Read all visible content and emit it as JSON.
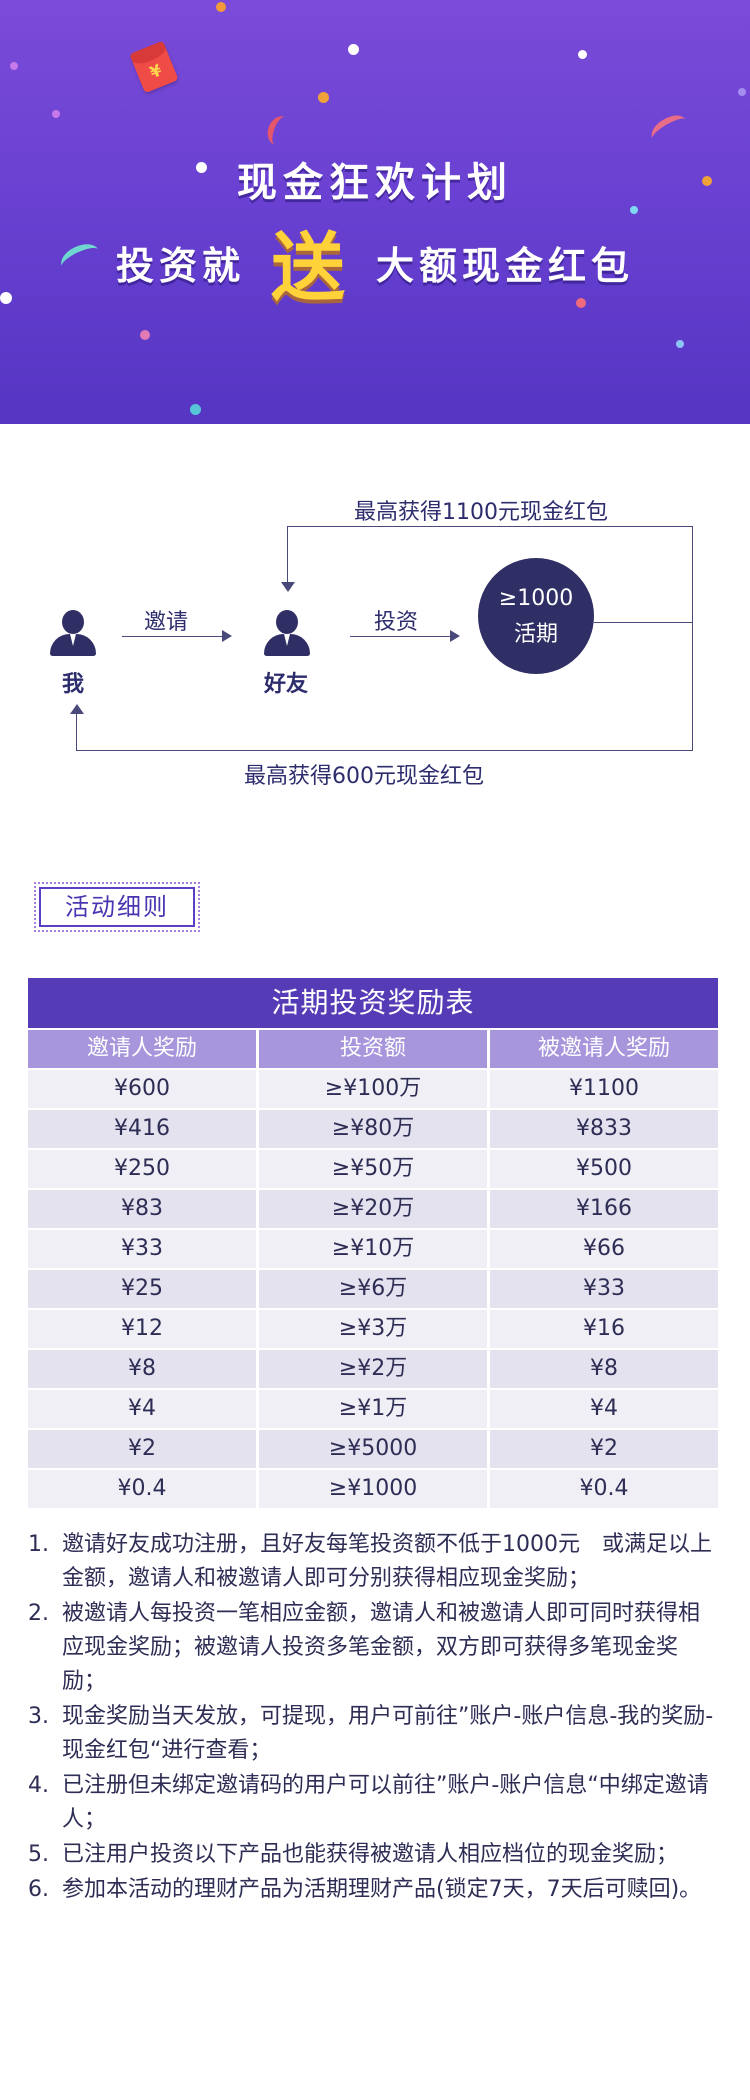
{
  "banner": {
    "title": "现金狂欢计划",
    "sub_before": "投资就",
    "sub_highlight": "送",
    "sub_after": "大额现金红包",
    "envelope_symbol": "¥",
    "colors": {
      "bg_top": "#7b4bd8",
      "bg_bottom": "#5635c3",
      "highlight": "#ffd23a"
    }
  },
  "flow": {
    "me_label": "我",
    "friend_label": "好友",
    "invite_label": "邀请",
    "invest_label": "投资",
    "circle_line1": "≥1000",
    "circle_line2": "活期",
    "top_reward": "最高获得1100元现金红包",
    "bottom_reward": "最高获得600元现金红包"
  },
  "details_tag": "活动细则",
  "table": {
    "title": "活期投资奖励表",
    "headers": [
      "邀请人奖励",
      "投资额",
      "被邀请人奖励"
    ],
    "rows": [
      [
        "¥600",
        "≥¥100万",
        "¥1100"
      ],
      [
        "¥416",
        "≥¥80万",
        "¥833"
      ],
      [
        "¥250",
        "≥¥50万",
        "¥500"
      ],
      [
        "¥83",
        "≥¥20万",
        "¥166"
      ],
      [
        "¥33",
        "≥¥10万",
        "¥66"
      ],
      [
        "¥25",
        "≥¥6万",
        "¥33"
      ],
      [
        "¥12",
        "≥¥3万",
        "¥16"
      ],
      [
        "¥8",
        "≥¥2万",
        "¥8"
      ],
      [
        "¥4",
        "≥¥1万",
        "¥4"
      ],
      [
        "¥2",
        "≥¥5000",
        "¥2"
      ],
      [
        "¥0.4",
        "≥¥1000",
        "¥0.4"
      ]
    ]
  },
  "rules": [
    {
      "num": "1.",
      "text": "邀请好友成功注册，且好友每笔投资额不低于1000元　或满足以上金额，邀请人和被邀请人即可分别获得相应现金奖励；"
    },
    {
      "num": "2.",
      "text": "被邀请人每投资一笔相应金额，邀请人和被邀请人即可同时获得相应现金奖励；被邀请人投资多笔金额，双方即可获得多笔现金奖励；"
    },
    {
      "num": "3.",
      "text": "现金奖励当天发放，可提现，用户可前往”账户-账户信息-我的奖励-现金红包“进行查看；"
    },
    {
      "num": "4.",
      "text": "已注册但未绑定邀请码的用户可以前往”账户-账户信息“中绑定邀请人；"
    },
    {
      "num": "5.",
      "text": "已注用户投资以下产品也能获得被邀请人相应档位的现金奖励；"
    },
    {
      "num": "6.",
      "text": "参加本活动的理财产品为活期理财产品(锁定7天，7天后可赎回)。"
    }
  ]
}
